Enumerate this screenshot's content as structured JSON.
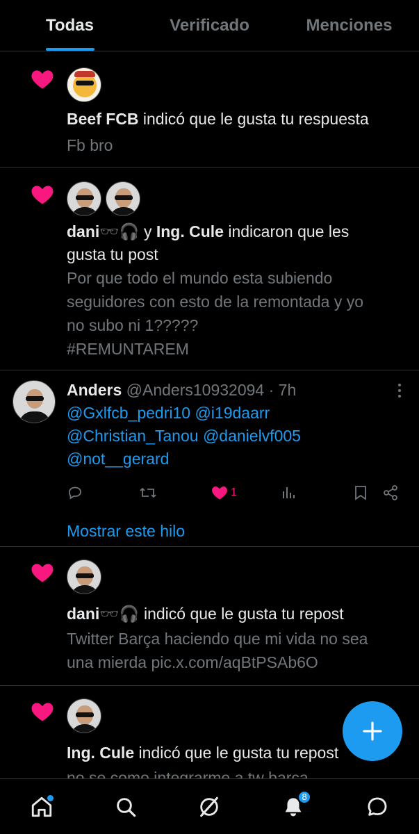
{
  "tabs": [
    {
      "label": "Todas",
      "active": true
    },
    {
      "label": "Verificado",
      "active": false
    },
    {
      "label": "Menciones",
      "active": false
    }
  ],
  "notifications": [
    {
      "type": "like",
      "actor1": "Beef FCB",
      "text": "indicó que le gusta tu respuesta",
      "preview": "Fb bro"
    },
    {
      "type": "like",
      "actor1": "dani🕶️🎧",
      "joiner": "y",
      "actor2": "Ing. Cule",
      "text_line1": "indicaron que les",
      "text_line2": "gusta tu post",
      "preview": [
        "Por que todo el mundo esta subiendo",
        "seguidores con esto de la remontada y yo",
        "no subo ni 1?????",
        "#REMUNTAREM"
      ]
    },
    {
      "type": "like",
      "actor1": "dani🕶️🎧",
      "text": "indicó que le gusta tu repost",
      "preview": [
        "Twitter Barça haciendo que mi vida no sea",
        "una mierda pic.x.com/aqBtPSAb6O"
      ]
    },
    {
      "type": "like",
      "actor1": "Ing. Cule",
      "text": "indicó que le gusta tu repost",
      "preview": "no se como integrarme a tw barca"
    }
  ],
  "post": {
    "name": "Anders",
    "handle": "@Anders10932094",
    "separator": "·",
    "time": "7h",
    "mentions_line1": [
      "@Gxlfcb_pedri10",
      "@i19daarr"
    ],
    "mentions_line2": [
      "@Christian_Tanou",
      "@danielvf005"
    ],
    "mentions_line3": [
      "@not__gerard"
    ],
    "like_count": "1",
    "show_thread": "Mostrar este hilo"
  },
  "bottom_nav": {
    "notifications_badge": "8"
  },
  "colors": {
    "accent": "#1d9bf0",
    "like": "#f91880",
    "muted": "#71767b",
    "text": "#e7e9ea",
    "border": "#2f3336"
  },
  "icons": {
    "like": "heart-icon",
    "reply": "reply-icon",
    "repost": "repost-icon",
    "views": "views-icon",
    "bookmark": "bookmark-icon",
    "share": "share-icon",
    "compose": "plus-icon",
    "home": "home-icon",
    "search": "search-icon",
    "grok": "grok-icon",
    "bell": "bell-icon",
    "messages": "messages-icon"
  }
}
